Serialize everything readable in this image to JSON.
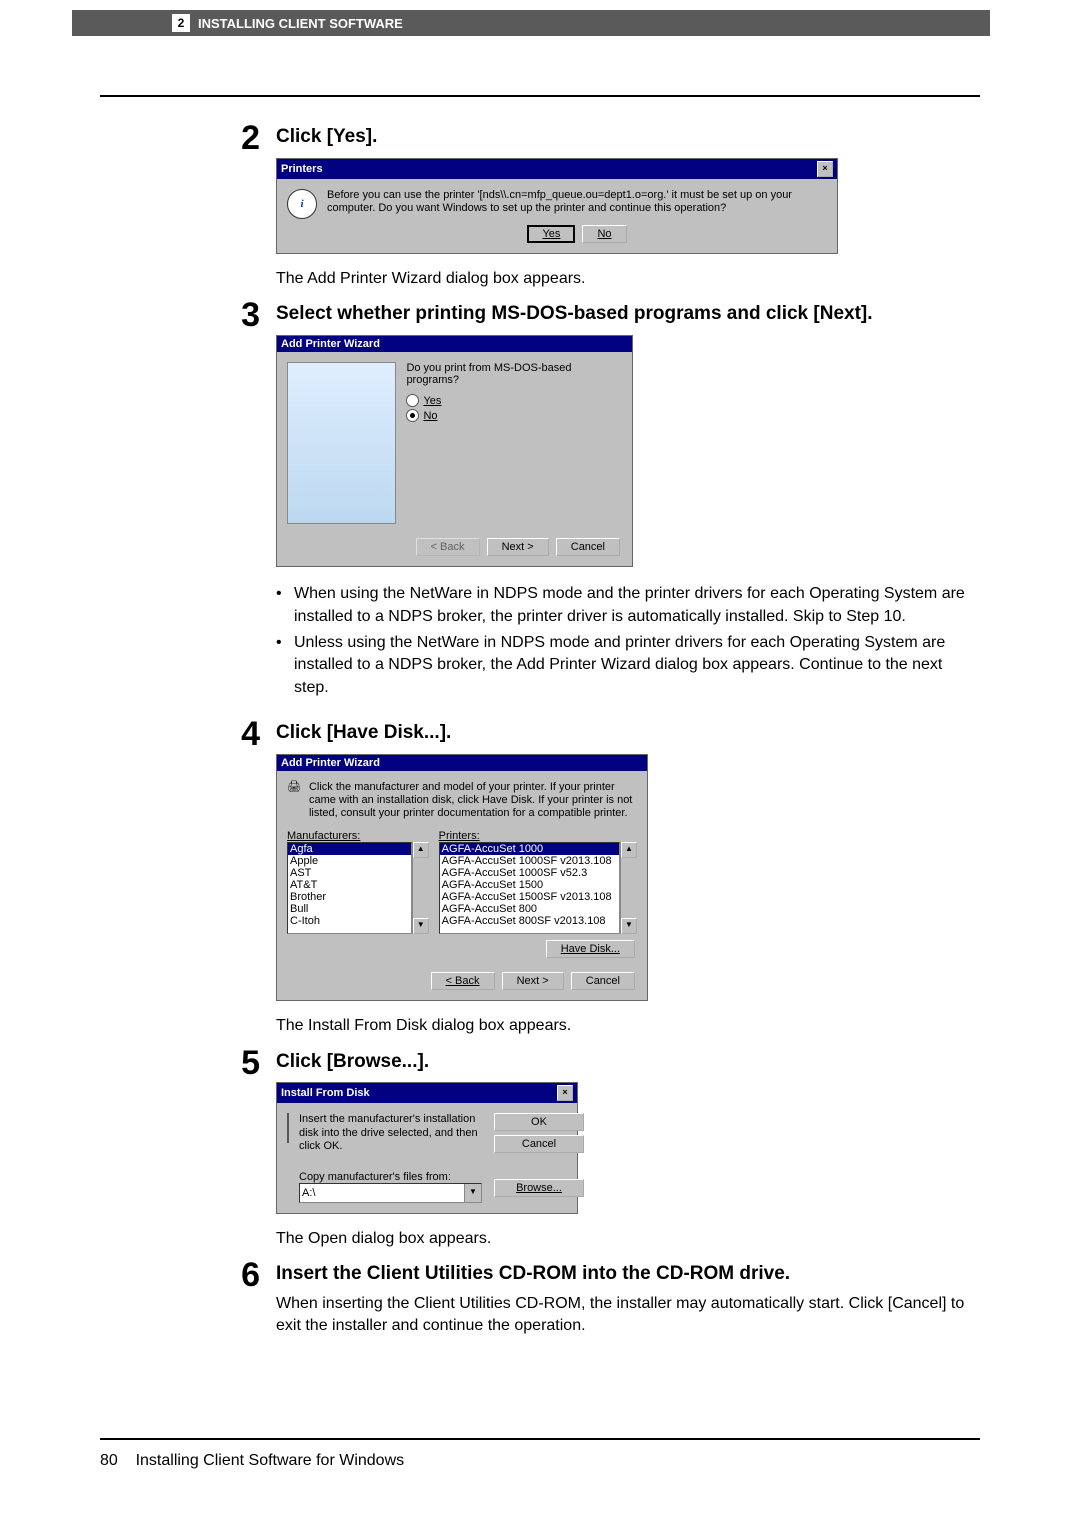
{
  "header": {
    "page_number": "2",
    "title": "INSTALLING CLIENT SOFTWARE"
  },
  "steps": {
    "s2": {
      "num": "2",
      "title": "Click [Yes].",
      "dialog": {
        "title": "Printers",
        "message": "Before you can use the printer '[nds\\\\.cn=mfp_queue.ou=dept1.o=org.' it must be set up on your computer. Do you want Windows to set up the printer and continue this operation?",
        "yes": "Yes",
        "no": "No"
      },
      "caption": "The Add Printer Wizard dialog box appears."
    },
    "s3": {
      "num": "3",
      "title": "Select whether printing MS-DOS-based programs and click [Next].",
      "dialog": {
        "title": "Add Printer Wizard",
        "question": "Do you print from MS-DOS-based programs?",
        "opt_yes": "Yes",
        "opt_no": "No",
        "back": "< Back",
        "next": "Next >",
        "cancel": "Cancel"
      },
      "bullets": [
        "When using the NetWare in NDPS mode and the printer drivers for each Operating System are installed to a NDPS broker, the printer driver is automatically installed. Skip to Step 10.",
        "Unless using the NetWare in NDPS mode and printer drivers for each Operating System are installed to a NDPS broker, the Add Printer Wizard dialog box appears. Continue to the next step."
      ]
    },
    "s4": {
      "num": "4",
      "title": "Click [Have Disk...].",
      "dialog": {
        "title": "Add Printer Wizard",
        "instruction": "Click the manufacturer and model of your printer. If your printer came with an installation disk, click Have Disk. If your printer is not listed, consult your printer documentation for a compatible printer.",
        "manu_label": "Manufacturers:",
        "printers_label": "Printers:",
        "manufacturers": [
          "Agfa",
          "Apple",
          "AST",
          "AT&T",
          "Brother",
          "Bull",
          "C-Itoh"
        ],
        "printers": [
          "AGFA-AccuSet 1000",
          "AGFA-AccuSet 1000SF v2013.108",
          "AGFA-AccuSet 1000SF v52.3",
          "AGFA-AccuSet 1500",
          "AGFA-AccuSet 1500SF v2013.108",
          "AGFA-AccuSet 800",
          "AGFA-AccuSet 800SF v2013.108"
        ],
        "have_disk": "Have Disk...",
        "back": "< Back",
        "next": "Next >",
        "cancel": "Cancel"
      },
      "caption": "The Install From Disk dialog box appears."
    },
    "s5": {
      "num": "5",
      "title": "Click [Browse...].",
      "dialog": {
        "title": "Install From Disk",
        "instruction": "Insert the manufacturer's installation disk into the drive selected, and then click OK.",
        "copy_label": "Copy manufacturer's files from:",
        "path": "A:\\",
        "ok": "OK",
        "cancel": "Cancel",
        "browse": "Browse..."
      },
      "caption": "The Open dialog box appears."
    },
    "s6": {
      "num": "6",
      "title": "Insert the Client Utilities CD-ROM into the CD-ROM drive.",
      "caption": "When inserting the Client Utilities CD-ROM, the installer may automatically start. Click [Cancel] to exit the installer and continue the operation."
    }
  },
  "footer": {
    "page": "80",
    "text": "Installing Client Software for Windows"
  }
}
